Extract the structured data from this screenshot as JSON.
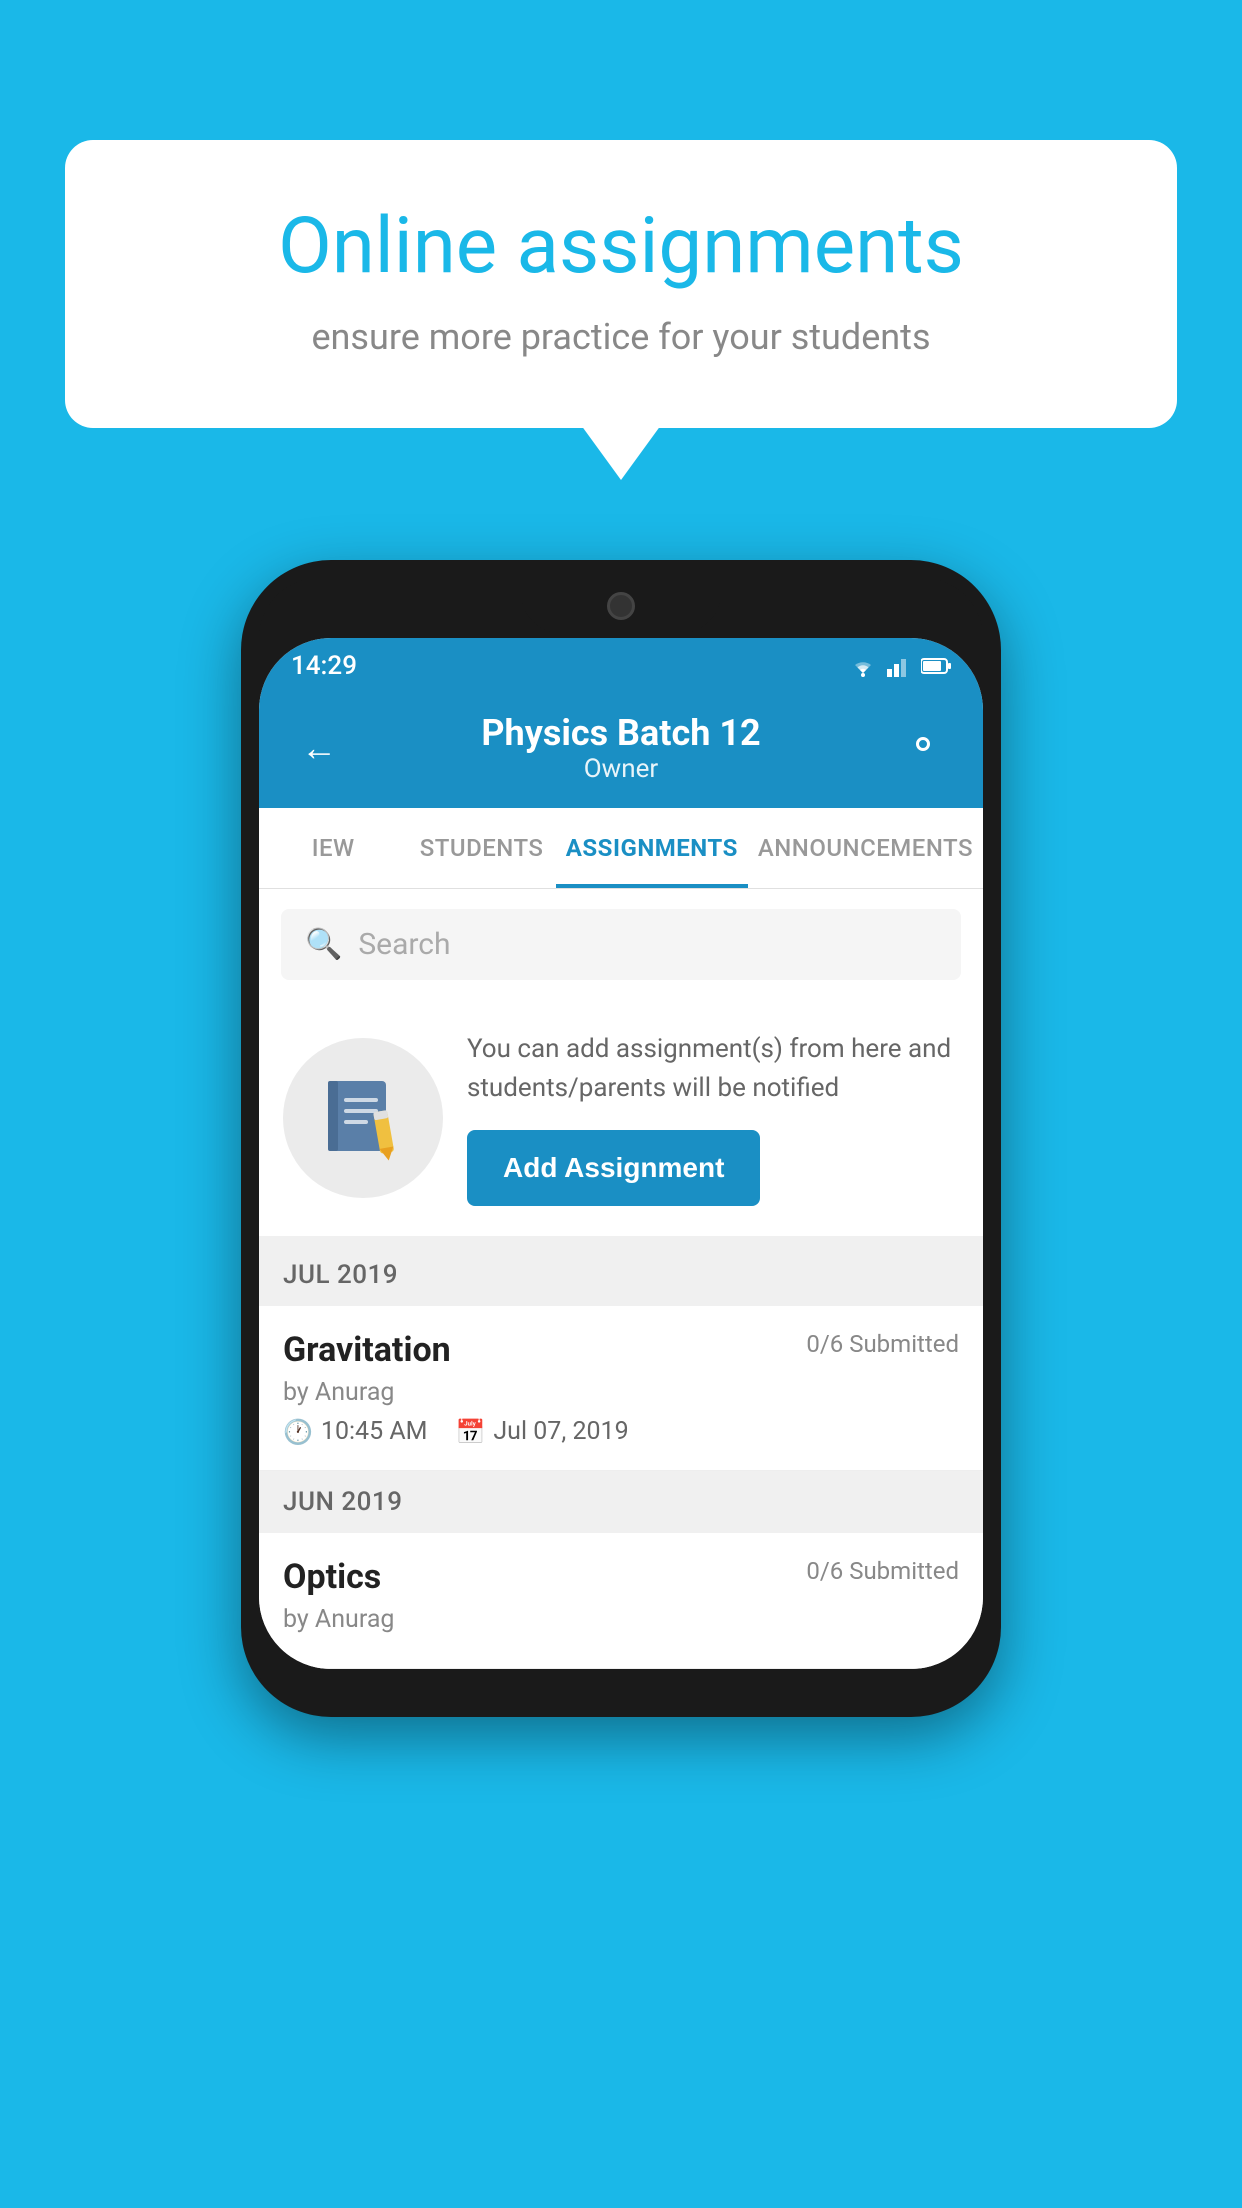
{
  "background_color": "#1ab8e8",
  "speech_bubble": {
    "title": "Online assignments",
    "subtitle": "ensure more practice for your students"
  },
  "phone": {
    "status_bar": {
      "time": "14:29",
      "icons": [
        "wifi",
        "signal",
        "battery"
      ]
    },
    "header": {
      "title": "Physics Batch 12",
      "subtitle": "Owner",
      "back_label": "←",
      "settings_label": "⚙"
    },
    "tabs": [
      {
        "label": "IEW",
        "active": false
      },
      {
        "label": "STUDENTS",
        "active": false
      },
      {
        "label": "ASSIGNMENTS",
        "active": true
      },
      {
        "label": "ANNOUNCEMENTS",
        "active": false
      }
    ],
    "search": {
      "placeholder": "Search"
    },
    "promo": {
      "text": "You can add assignment(s) from here and students/parents will be notified",
      "button_label": "Add Assignment"
    },
    "sections": [
      {
        "month_label": "JUL 2019",
        "assignments": [
          {
            "title": "Gravitation",
            "submitted": "0/6 Submitted",
            "by": "by Anurag",
            "time": "10:45 AM",
            "date": "Jul 07, 2019"
          }
        ]
      },
      {
        "month_label": "JUN 2019",
        "assignments": [
          {
            "title": "Optics",
            "submitted": "0/6 Submitted",
            "by": "by Anurag",
            "time": "",
            "date": ""
          }
        ]
      }
    ]
  }
}
